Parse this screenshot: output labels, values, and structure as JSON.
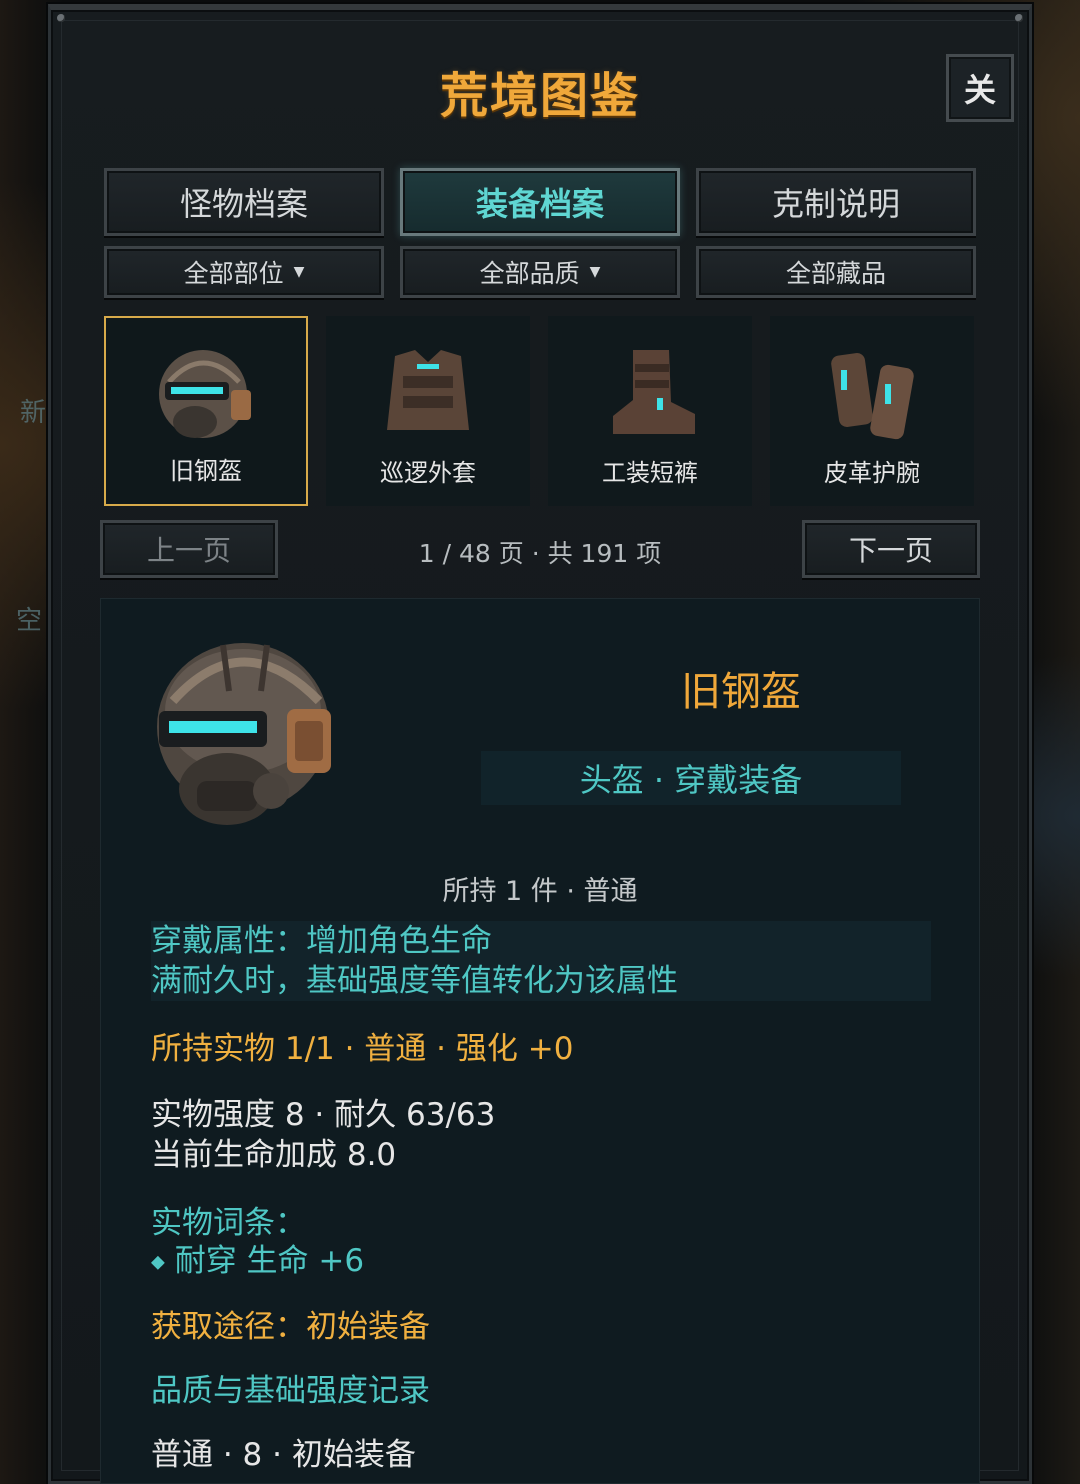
{
  "window": {
    "title": "荒境图鉴",
    "close_label": "关"
  },
  "tabs": [
    {
      "label": "怪物档案",
      "active": false
    },
    {
      "label": "装备档案",
      "active": true
    },
    {
      "label": "克制说明",
      "active": false
    }
  ],
  "filters": [
    {
      "label": "全部部位",
      "has_dropdown": true
    },
    {
      "label": "全部品质",
      "has_dropdown": true
    },
    {
      "label": "全部藏品",
      "has_dropdown": false
    }
  ],
  "items": [
    {
      "label": "旧钢盔",
      "icon": "helmet-icon",
      "selected": true
    },
    {
      "label": "巡逻外套",
      "icon": "vest-icon",
      "selected": false
    },
    {
      "label": "工装短裤",
      "icon": "boots-icon",
      "selected": false
    },
    {
      "label": "皮革护腕",
      "icon": "bracers-icon",
      "selected": false
    }
  ],
  "pager": {
    "prev_label": "上一页",
    "next_label": "下一页",
    "info": "1 / 48 页 · 共 191 项"
  },
  "detail": {
    "name": "旧钢盔",
    "type": "头盔 · 穿戴装备",
    "owned": "所持 1 件 · 普通",
    "wear_attr_line1": "穿戴属性：增加角色生命",
    "wear_attr_line2": "满耐久时，基础强度等值转化为该属性",
    "held_item": "所持实物 1/1 · 普通 · 强化 +0",
    "strength": "实物强度 8 · 耐久 63/63",
    "life_bonus": "当前生命加成 8.0",
    "affix_title": "实物词条：",
    "affix_bullet": "◆",
    "affix_item": "耐穿 生命 +6",
    "source": "获取途径：初始装备",
    "record_title": "品质与基础强度记录",
    "record_item": "普通 · 8 · 初始装备"
  },
  "colors": {
    "accent_gold": "#f0a83a",
    "accent_cyan": "#4fc7c4",
    "selected_border": "#d7aa4a"
  },
  "world": {
    "sign_left_1": "新",
    "sign_left_2": "空"
  }
}
